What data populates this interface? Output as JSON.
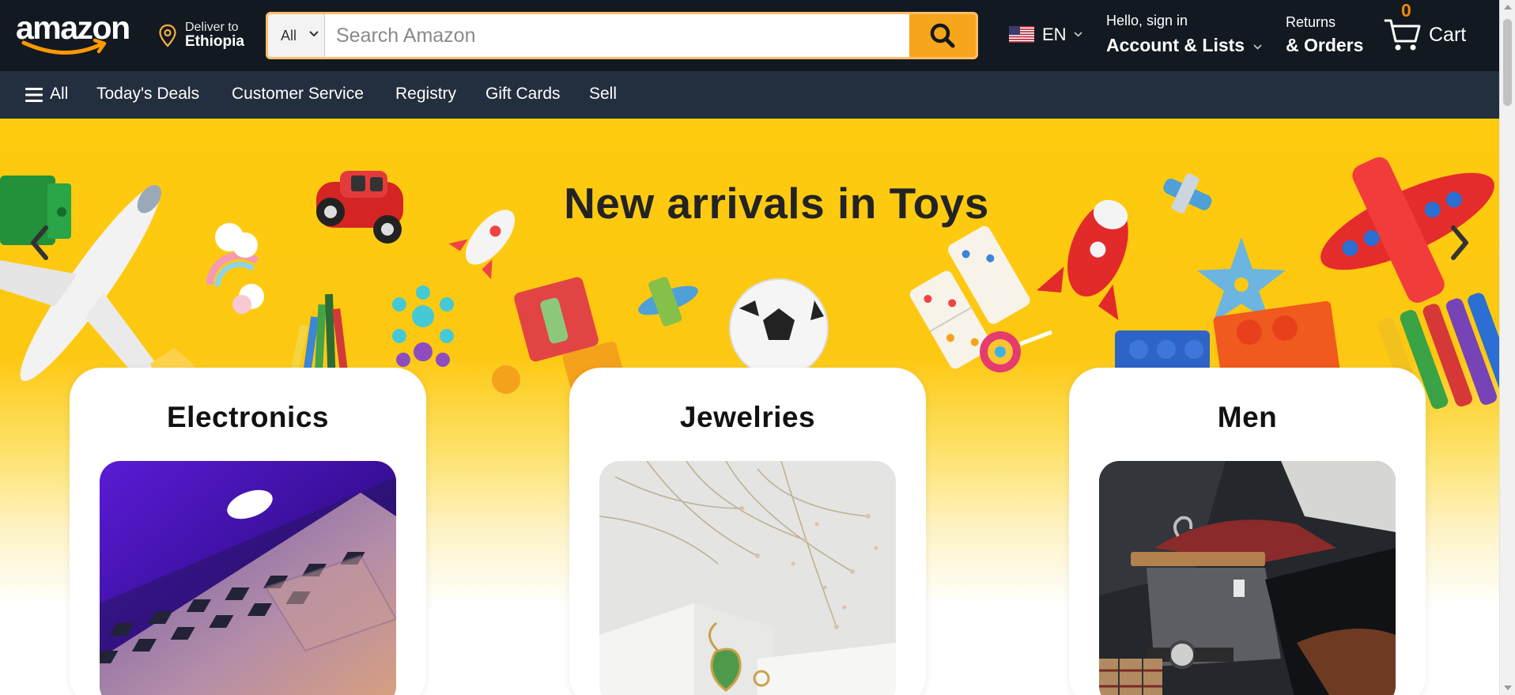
{
  "header": {
    "logo_text": "amazon",
    "deliver_line1": "Deliver to",
    "deliver_location": "Ethiopia",
    "search_category": "All",
    "search_placeholder": "Search Amazon",
    "language": "EN",
    "account_greeting": "Hello, sign in",
    "account_label": "Account & Lists",
    "returns_label": "Returns",
    "orders_label": "& Orders",
    "cart_count": "0",
    "cart_label": "Cart"
  },
  "subnav": {
    "menu_label": "All",
    "items": [
      "Today's Deals",
      "Customer Service",
      "Registry",
      "Gift Cards",
      "Sell"
    ]
  },
  "hero": {
    "title": "New arrivals in Toys"
  },
  "categories": [
    {
      "title": "Electronics",
      "image": "laptop-image"
    },
    {
      "title": "Jewelries",
      "image": "jewelry-image"
    },
    {
      "title": "Men",
      "image": "mens-clothing-image"
    }
  ],
  "colors": {
    "header_bg": "#131921",
    "subnav_bg": "#232f3e",
    "search_button": "#f7a51a",
    "hero_yellow": "#fecb0f",
    "cart_count": "#f08804"
  }
}
